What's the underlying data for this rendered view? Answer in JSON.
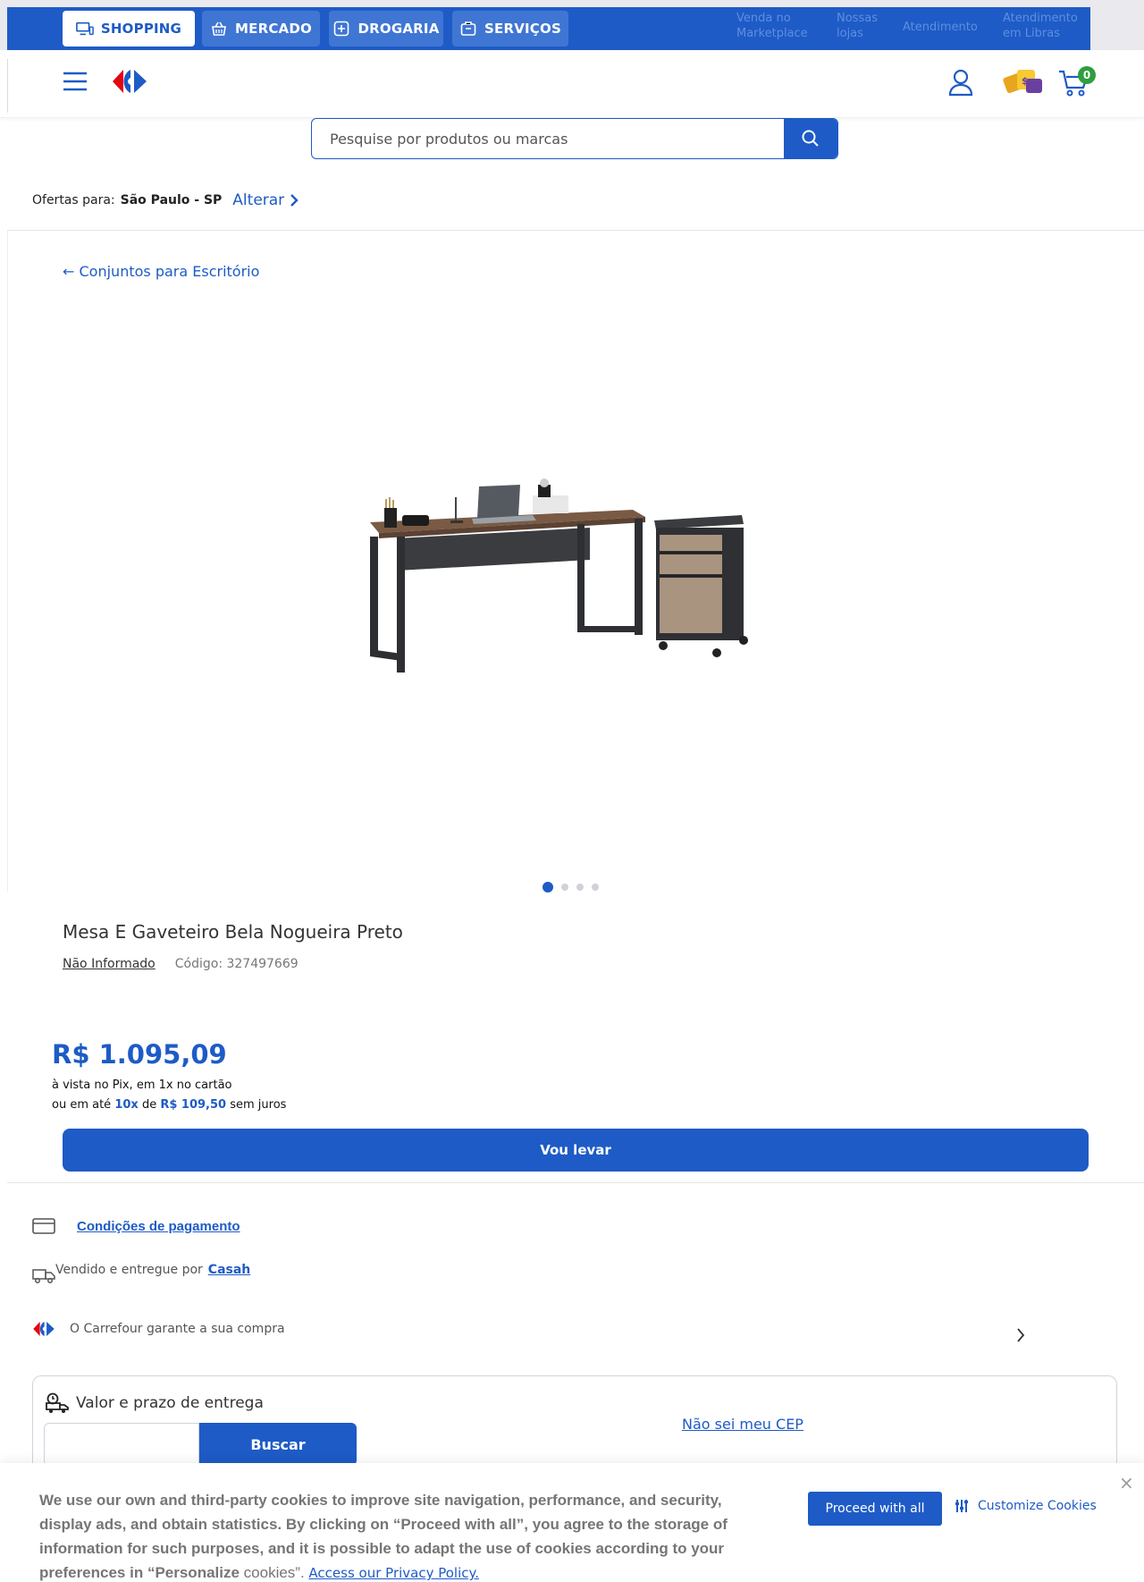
{
  "top_nav": {
    "tabs": [
      {
        "label": "SHOPPING",
        "icon": "computer-icon"
      },
      {
        "label": "MERCADO",
        "icon": "basket-icon"
      },
      {
        "label": "DROGARIA",
        "icon": "pharmacy-icon"
      },
      {
        "label": "SERVIÇOS",
        "icon": "services-icon"
      }
    ],
    "links": [
      {
        "line1": "Venda no",
        "line2": "Marketplace"
      },
      {
        "line1": "Nossas",
        "line2": "lojas"
      },
      {
        "line1": "Atendimento",
        "line2": ""
      },
      {
        "line1": "Atendimento",
        "line2": "em Libras"
      }
    ]
  },
  "header": {
    "cart_count": "0"
  },
  "search": {
    "placeholder": "Pesquise por produtos ou marcas"
  },
  "location": {
    "prefix": "Ofertas para:",
    "city": "São Paulo - SP",
    "change": "Alterar"
  },
  "breadcrumb": {
    "label": "Conjuntos para Escritório"
  },
  "product": {
    "title": "Mesa E Gaveteiro Bela Nogueira Preto",
    "brand": "Não Informado",
    "code": "Código: 327497669",
    "price": "R$ 1.095,09",
    "price_line1": "à vista no Pix, em 1x no cartão",
    "installments_prefix": "ou em até",
    "installments_count": "10x",
    "installments_mid": "de",
    "installment_value": "R$ 109,50",
    "installments_suffix": "sem juros",
    "buy_label": "Vou levar",
    "gallery_total": 4,
    "gallery_active": 1
  },
  "details": {
    "payment": "Condições de pagamento",
    "sold_by_prefix": "Vendido e entregue por",
    "seller": "Casah",
    "guarantee": "O Carrefour garante a sua compra"
  },
  "shipping": {
    "title": "Valor e prazo de entrega",
    "button": "Buscar",
    "unknown_cep": "Não sei meu CEP"
  },
  "cookie": {
    "text_bold": "We use our own and third-party cookies to improve site navigation, performance, and security, display ads, and obtain statistics. By clicking on “Proceed with all”, you agree to the storage of information for such purposes, and it is possible to adapt the use of cookies according to your preferences in “Personalize",
    "text_plain": " cookies”.",
    "privacy_link": "Access our Privacy Policy.",
    "proceed": "Proceed with all",
    "customize": "Customize Cookies",
    "close": "×"
  },
  "colors": {
    "brand_blue": "#1e5bc6",
    "carrefour_red": "#e30613",
    "cart_badge": "#2e9e3e"
  }
}
